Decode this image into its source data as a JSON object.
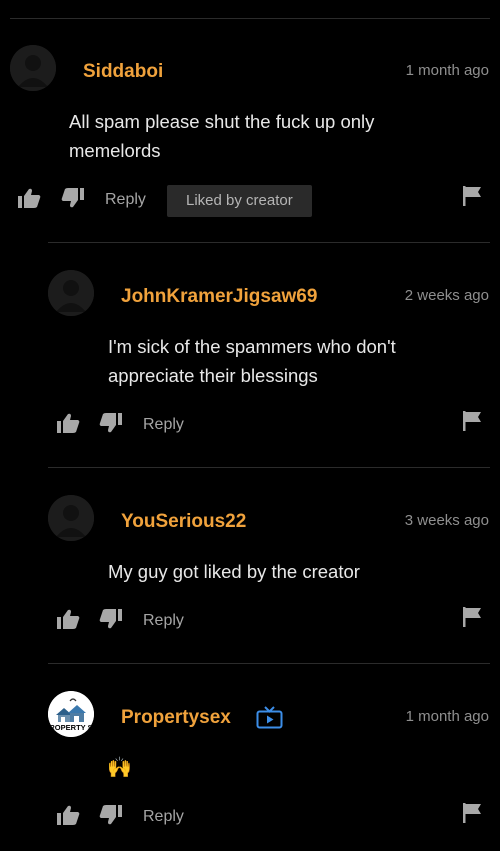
{
  "comments": [
    {
      "username": "Siddaboi",
      "timestamp": "1 month ago",
      "text_lines": [
        "All spam please shut the fuck up only",
        "memelords"
      ],
      "reply_label": "Reply",
      "badge": "Liked by creator"
    },
    {
      "username": "JohnKramerJigsaw69",
      "timestamp": "2 weeks ago",
      "text_lines": [
        "I'm sick of the spammers who don't",
        "appreciate their blessings"
      ],
      "reply_label": "Reply"
    },
    {
      "username": "YouSerious22",
      "timestamp": "3 weeks ago",
      "text_lines": [
        "My guy got liked by the creator"
      ],
      "reply_label": "Reply"
    },
    {
      "username": "Propertysex",
      "timestamp": "1 month ago",
      "text": "🙌",
      "avatar_text": "PROPERTY SE",
      "reply_label": "Reply"
    }
  ],
  "icons": {
    "thumbs_up": "thumbs-up-icon",
    "thumbs_down": "thumbs-down-icon",
    "flag": "flag-icon",
    "avatar_placeholder": "default-avatar-icon",
    "creator_channel": "tv-icon"
  },
  "colors": {
    "background": "#000000",
    "username": "#f0a23c",
    "timestamp": "#8f8f8f",
    "text": "#e8e8e8",
    "badge_bg": "#2a2a2a",
    "tv_icon": "#3c8ee8"
  }
}
